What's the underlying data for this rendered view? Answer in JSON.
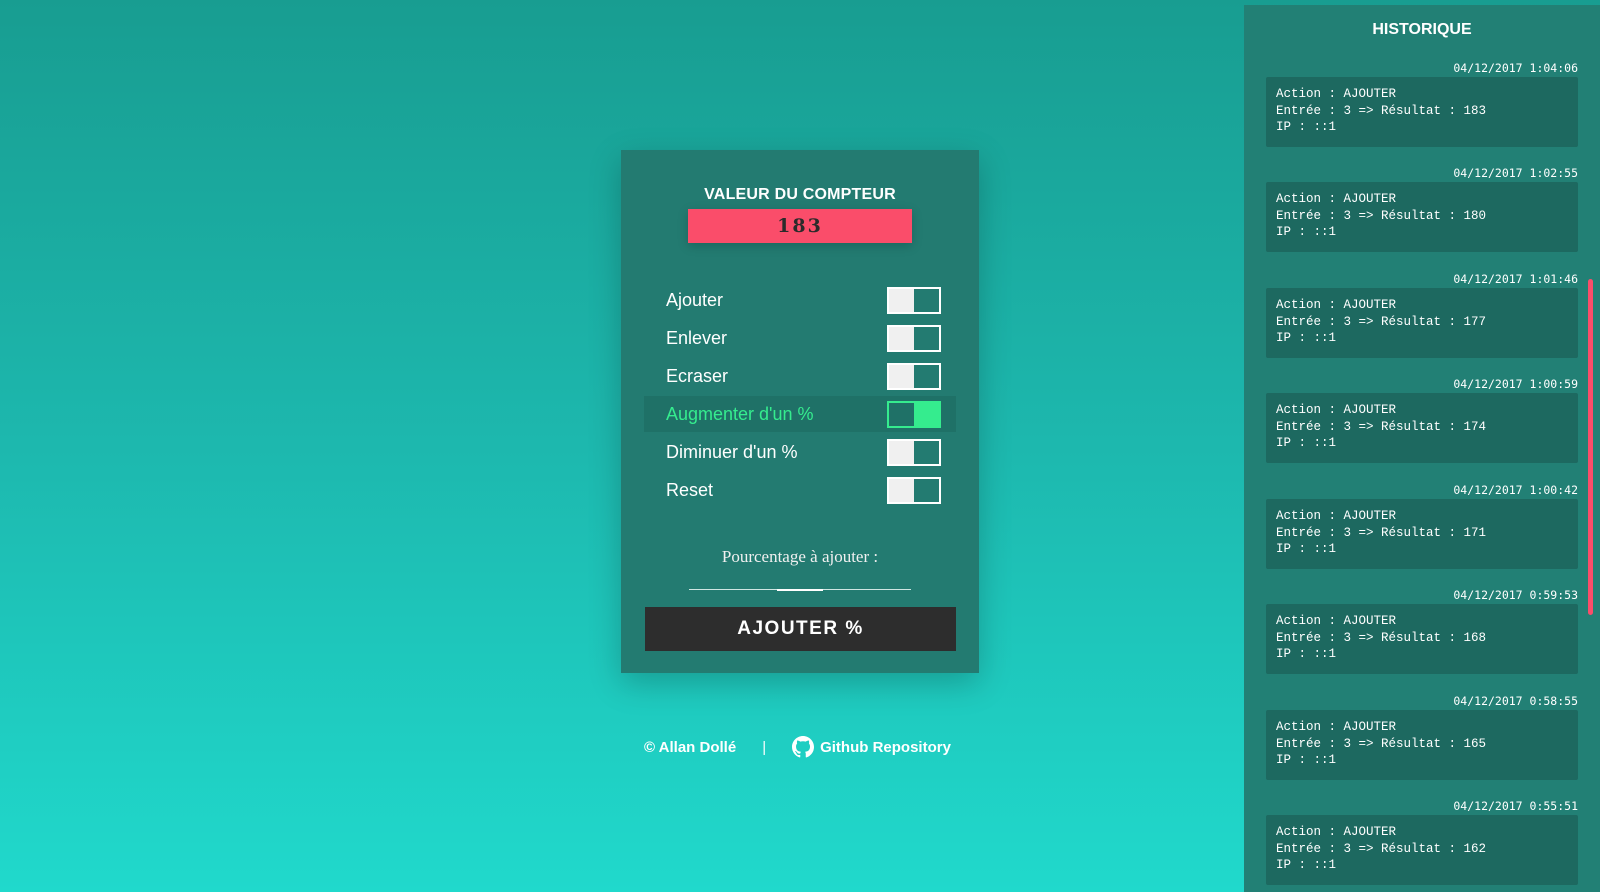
{
  "counter": {
    "title": "VALEUR DU COMPTEUR",
    "value": "183"
  },
  "options": [
    {
      "label": "Ajouter",
      "active": false
    },
    {
      "label": "Enlever",
      "active": false
    },
    {
      "label": "Ecraser",
      "active": false
    },
    {
      "label": "Augmenter d'un %",
      "active": true
    },
    {
      "label": "Diminuer d'un %",
      "active": false
    },
    {
      "label": "Reset",
      "active": false
    }
  ],
  "percentage": {
    "label": "Pourcentage à ajouter :",
    "value": ""
  },
  "submit": {
    "label": "AJOUTER %"
  },
  "footer": {
    "copyright": "© Allan Dollé",
    "separator": "|",
    "github_label": "Github Repository",
    "github_icon": "github-icon"
  },
  "history": {
    "title": "HISTORIQUE",
    "entries": [
      {
        "timestamp": "04/12/2017 1:04:06",
        "action": "Action : AJOUTER",
        "detail": "Entrée : 3 => Résultat : 183",
        "ip": "IP : ::1"
      },
      {
        "timestamp": "04/12/2017 1:02:55",
        "action": "Action : AJOUTER",
        "detail": "Entrée : 3 => Résultat : 180",
        "ip": "IP : ::1"
      },
      {
        "timestamp": "04/12/2017 1:01:46",
        "action": "Action : AJOUTER",
        "detail": "Entrée : 3 => Résultat : 177",
        "ip": "IP : ::1"
      },
      {
        "timestamp": "04/12/2017 1:00:59",
        "action": "Action : AJOUTER",
        "detail": "Entrée : 3 => Résultat : 174",
        "ip": "IP : ::1"
      },
      {
        "timestamp": "04/12/2017 1:00:42",
        "action": "Action : AJOUTER",
        "detail": "Entrée : 3 => Résultat : 171",
        "ip": "IP : ::1"
      },
      {
        "timestamp": "04/12/2017 0:59:53",
        "action": "Action : AJOUTER",
        "detail": "Entrée : 3 => Résultat : 168",
        "ip": "IP : ::1"
      },
      {
        "timestamp": "04/12/2017 0:58:55",
        "action": "Action : AJOUTER",
        "detail": "Entrée : 3 => Résultat : 165",
        "ip": "IP : ::1"
      },
      {
        "timestamp": "04/12/2017 0:55:51",
        "action": "Action : AJOUTER",
        "detail": "Entrée : 3 => Résultat : 162",
        "ip": "IP : ::1"
      }
    ]
  },
  "colors": {
    "accent": "#fa4d6a",
    "active_green": "#35ec8e",
    "card_bg": "#237b71",
    "button_bg": "#2d2d2d"
  }
}
